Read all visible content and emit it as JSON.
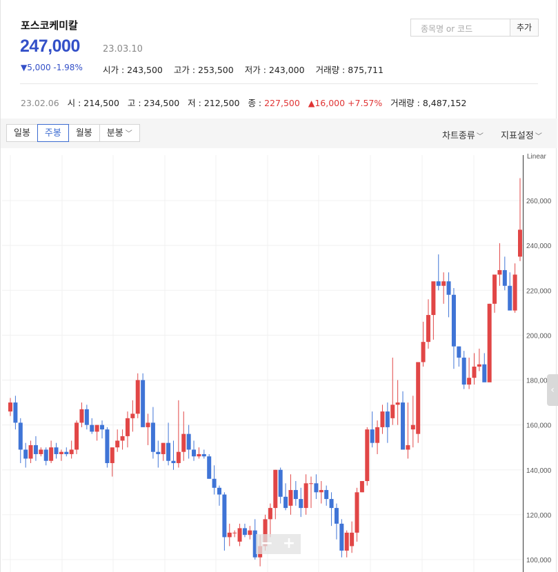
{
  "stock": {
    "name": "포스코케미칼",
    "price": "247,000",
    "date": "23.03.10",
    "change": "▼5,000 -1.98%",
    "open": "시가 : 243,500",
    "high": "고가 : 253,500",
    "low": "저가 : 243,000",
    "volume": "거래량 : 875,711"
  },
  "search": {
    "placeholder": "종목명 or 코드",
    "add_label": "추가"
  },
  "prev": {
    "date": "23.02.06",
    "open": "시 : 214,500",
    "high": "고 : 234,500",
    "low": "저 : 212,500",
    "close_label": "종 : ",
    "close": "227,500",
    "change": "▲16,000 +7.57%",
    "volume": "거래량 : 8,487,152"
  },
  "tabs": [
    {
      "label": "일봉"
    },
    {
      "label": "주봉"
    },
    {
      "label": "월봉"
    },
    {
      "label": "분봉"
    }
  ],
  "toolbar": {
    "chart_type": "차트종류",
    "indicator": "지표설정"
  },
  "zoom": {
    "minus": "−",
    "plus": "+"
  },
  "colors": {
    "up": "#e14646",
    "down": "#3f74d6",
    "accent": "#3350c8"
  },
  "chart_data": {
    "type": "candlestick",
    "scale_label": "Linear",
    "y_ticks": [
      "100,000",
      "120,000",
      "140,000",
      "160,000",
      "180,000",
      "200,000",
      "220,000",
      "240,000",
      "260,000"
    ],
    "ylim": [
      95000,
      276000
    ],
    "candles": [
      [
        166000,
        172000,
        164000,
        170000
      ],
      [
        170000,
        173000,
        158000,
        161000
      ],
      [
        161000,
        163000,
        143000,
        149000
      ],
      [
        149000,
        152000,
        141000,
        145000
      ],
      [
        145000,
        153000,
        143000,
        151000
      ],
      [
        151000,
        155000,
        144000,
        147000
      ],
      [
        147000,
        150000,
        146000,
        149000
      ],
      [
        149000,
        150000,
        142000,
        144000
      ],
      [
        144000,
        153000,
        143000,
        150000
      ],
      [
        150000,
        152000,
        145000,
        147000
      ],
      [
        147000,
        149000,
        144000,
        148000
      ],
      [
        148000,
        150000,
        146000,
        147000
      ],
      [
        147000,
        153000,
        145000,
        149000
      ],
      [
        149000,
        162000,
        147000,
        161000
      ],
      [
        161000,
        170000,
        159000,
        167000
      ],
      [
        167000,
        169000,
        158000,
        160000
      ],
      [
        160000,
        163000,
        156000,
        157000
      ],
      [
        157000,
        160000,
        153000,
        160000
      ],
      [
        160000,
        162000,
        154000,
        158000
      ],
      [
        158000,
        159000,
        141000,
        143000
      ],
      [
        143000,
        150000,
        137000,
        150000
      ],
      [
        150000,
        158000,
        148000,
        153000
      ],
      [
        153000,
        158000,
        149000,
        155000
      ],
      [
        155000,
        166000,
        150000,
        163000
      ],
      [
        163000,
        171000,
        157000,
        165000
      ],
      [
        165000,
        183000,
        163000,
        180000
      ],
      [
        180000,
        183000,
        162000,
        159000
      ],
      [
        159000,
        165000,
        151000,
        161000
      ],
      [
        161000,
        168000,
        145000,
        148000
      ],
      [
        148000,
        153000,
        141000,
        147000
      ],
      [
        147000,
        152000,
        144000,
        152000
      ],
      [
        152000,
        161000,
        142000,
        144000
      ],
      [
        144000,
        153000,
        140000,
        143000
      ],
      [
        143000,
        171000,
        141000,
        148000
      ],
      [
        148000,
        166000,
        144000,
        156000
      ],
      [
        156000,
        160000,
        145000,
        149000
      ],
      [
        149000,
        153000,
        144000,
        146000
      ],
      [
        146000,
        150000,
        145000,
        147000
      ],
      [
        147000,
        149000,
        145000,
        146000
      ],
      [
        146000,
        147000,
        136000,
        136000
      ],
      [
        136000,
        142000,
        129000,
        132000
      ],
      [
        132000,
        133000,
        124000,
        129000
      ],
      [
        129000,
        130000,
        104000,
        110000
      ],
      [
        110000,
        116000,
        106000,
        112000
      ],
      [
        112000,
        113000,
        110000,
        112000
      ],
      [
        108000,
        116000,
        106000,
        114000
      ],
      [
        114000,
        116000,
        110000,
        111000
      ],
      [
        111000,
        115000,
        109000,
        113000
      ],
      [
        113000,
        118000,
        100000,
        101000
      ],
      [
        101000,
        111000,
        97000,
        106000
      ],
      [
        106000,
        120000,
        104000,
        118000
      ],
      [
        118000,
        125000,
        110000,
        123000
      ],
      [
        123000,
        140000,
        118000,
        140000
      ],
      [
        140000,
        141000,
        125000,
        128000
      ],
      [
        128000,
        134000,
        122000,
        123000
      ],
      [
        124000,
        138000,
        120000,
        131000
      ],
      [
        131000,
        135000,
        124000,
        127000
      ],
      [
        127000,
        132000,
        119000,
        123000
      ],
      [
        123000,
        138000,
        120000,
        134000
      ],
      [
        134000,
        137000,
        123000,
        134000
      ],
      [
        134000,
        138000,
        127000,
        130000
      ],
      [
        130000,
        135000,
        125000,
        131000
      ],
      [
        131000,
        133000,
        124000,
        127000
      ],
      [
        127000,
        130000,
        115000,
        123000
      ],
      [
        123000,
        125000,
        109000,
        116000
      ],
      [
        116000,
        118000,
        101000,
        104000
      ],
      [
        104000,
        113000,
        101000,
        112000
      ],
      [
        106000,
        117000,
        103000,
        112000
      ],
      [
        112000,
        132000,
        108000,
        130000
      ],
      [
        130000,
        135000,
        130000,
        135000
      ],
      [
        135000,
        159000,
        133000,
        158000
      ],
      [
        158000,
        166000,
        150000,
        152000
      ],
      [
        152000,
        162000,
        147000,
        159000
      ],
      [
        159000,
        169000,
        156000,
        166000
      ],
      [
        166000,
        170000,
        152000,
        159000
      ],
      [
        163000,
        190000,
        160000,
        169000
      ],
      [
        169000,
        180000,
        160000,
        170000
      ],
      [
        170000,
        175000,
        150000,
        149000
      ],
      [
        149000,
        170000,
        145000,
        151000
      ],
      [
        158000,
        173000,
        150000,
        160000
      ],
      [
        156000,
        171000,
        152000,
        188000
      ],
      [
        188000,
        206000,
        186000,
        197000
      ],
      [
        197000,
        216000,
        194000,
        209000
      ],
      [
        209000,
        222000,
        198000,
        224000
      ],
      [
        224000,
        236000,
        220000,
        222000
      ],
      [
        222000,
        228000,
        214000,
        224000
      ],
      [
        224000,
        228000,
        208000,
        218000
      ],
      [
        218000,
        221000,
        185000,
        195000
      ],
      [
        195000,
        195000,
        186000,
        190000
      ],
      [
        190000,
        193000,
        176000,
        178000
      ],
      [
        178000,
        190000,
        176000,
        181000
      ],
      [
        181000,
        192000,
        178000,
        186000
      ],
      [
        186000,
        194000,
        184000,
        187000
      ],
      [
        187000,
        192000,
        180000,
        179000
      ],
      [
        179000,
        214000,
        180000,
        214000
      ],
      [
        214000,
        226000,
        210000,
        227000
      ],
      [
        227000,
        241000,
        222000,
        229000
      ],
      [
        229000,
        235000,
        220000,
        222000
      ],
      [
        222000,
        228000,
        217000,
        211000
      ],
      [
        211000,
        232000,
        210000,
        227000
      ],
      [
        235000,
        270000,
        233000,
        247000
      ]
    ]
  }
}
